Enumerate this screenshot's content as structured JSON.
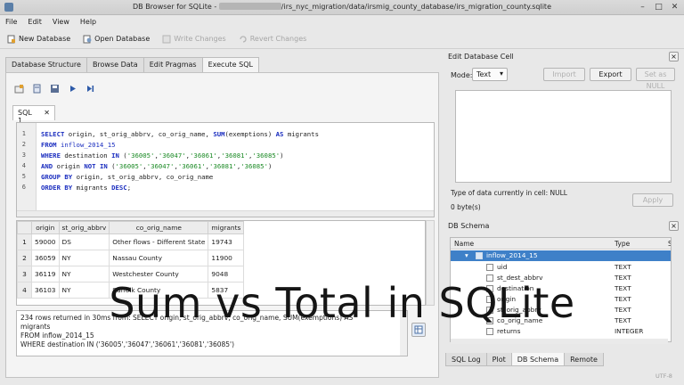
{
  "window": {
    "title_prefix": "DB Browser for SQLite - ",
    "title_path": "/irs_nyc_migration/data/irsmig_county_database/irs_migration_county.sqlite",
    "controls": [
      "–",
      "□",
      "✕"
    ]
  },
  "menu": [
    "File",
    "Edit",
    "View",
    "Help"
  ],
  "toolbar": {
    "new_db": "New Database",
    "open_db": "Open Database",
    "write_changes": "Write Changes",
    "revert_changes": "Revert Changes"
  },
  "tabs": [
    "Database Structure",
    "Browse Data",
    "Edit Pragmas",
    "Execute SQL"
  ],
  "active_tab": "Execute SQL",
  "sql_tab": {
    "label": "SQL 1",
    "close": "✕"
  },
  "editor": {
    "line_numbers": [
      "1",
      "2",
      "3",
      "4",
      "5",
      "6"
    ],
    "lines": [
      "SELECT origin, st_orig_abbrv, co_orig_name, SUM(exemptions) AS migrants",
      "FROM inflow_2014_15",
      "WHERE destination IN ('36005','36047','36061','36081','36085')",
      "AND origin NOT IN ('36005','36047','36061','36081','36085')",
      "GROUP BY origin, st_orig_abbrv, co_orig_name",
      "ORDER BY migrants DESC;"
    ]
  },
  "results": {
    "columns": [
      "origin",
      "st_orig_abbrv",
      "co_orig_name",
      "migrants"
    ],
    "rows": [
      [
        "1",
        "59000",
        "DS",
        "Other flows - Different State",
        "19743"
      ],
      [
        "2",
        "36059",
        "NY",
        "Nassau County",
        "11900"
      ],
      [
        "3",
        "36119",
        "NY",
        "Westchester County",
        "9048"
      ],
      [
        "4",
        "36103",
        "NY",
        "Suffolk County",
        "5837"
      ]
    ]
  },
  "messages": {
    "line1": "234 rows returned in 30ms from: SELECT origin, st_orig_abbrv, co_orig_name, SUM(exemptions) AS",
    "line2": "migrants",
    "line3": "FROM inflow_2014_15",
    "line4": "WHERE destination IN ('36005','36047','36061','36081','36085')"
  },
  "edit_cell": {
    "title": "Edit Database Cell",
    "mode_label": "Mode:",
    "mode_value": "Text",
    "import": "Import",
    "export": "Export",
    "set_null": "Set as NULL",
    "type_text": "Type of data currently in cell: NULL",
    "size_text": "0 byte(s)",
    "apply": "Apply"
  },
  "schema": {
    "title": "DB Schema",
    "col_name": "Name",
    "col_type": "Type",
    "col_schema": "S",
    "table": "inflow_2014_15",
    "fields": [
      {
        "name": "uid",
        "type": "TEXT"
      },
      {
        "name": "st_dest_abbrv",
        "type": "TEXT"
      },
      {
        "name": "destination",
        "type": "TEXT"
      },
      {
        "name": "origin",
        "type": "TEXT"
      },
      {
        "name": "st_orig_abbrv",
        "type": "TEXT"
      },
      {
        "name": "co_orig_name",
        "type": "TEXT"
      },
      {
        "name": "returns",
        "type": "INTEGER"
      }
    ]
  },
  "dock_tabs": [
    "SQL Log",
    "Plot",
    "DB Schema",
    "Remote"
  ],
  "active_dock_tab": "DB Schema",
  "encoding": "UTF-8",
  "overlay_title": "Sum vs Total in SQLite"
}
